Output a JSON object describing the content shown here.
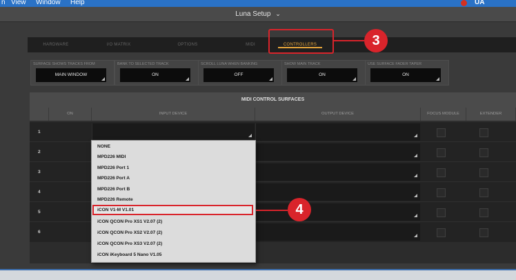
{
  "menubar": {
    "items": [
      "n",
      "View",
      "Window",
      "Help"
    ],
    "right_label": "UA"
  },
  "window": {
    "title": "Luna Setup"
  },
  "tabs": [
    {
      "label": "HARDWARE",
      "active": false
    },
    {
      "label": "I/O MATRIX",
      "active": false
    },
    {
      "label": "OPTIONS",
      "active": false
    },
    {
      "label": "MIDI",
      "active": false
    },
    {
      "label": "CONTROLLERS",
      "active": true
    }
  ],
  "callouts": {
    "step3": "3",
    "step4": "4"
  },
  "settings": [
    {
      "label": "SURFACE SHOWS TRACKS FROM",
      "value": "MAIN WINDOW"
    },
    {
      "label": "BANK TO SELECTED TRACK",
      "value": "ON"
    },
    {
      "label": "SCROLL LUNA WHEN BANKING",
      "value": "OFF"
    },
    {
      "label": "SHOW MAIN TRACK",
      "value": "ON"
    },
    {
      "label": "USE SURFACE FADER TAPER",
      "value": "ON"
    }
  ],
  "midi_section": {
    "title": "MIDI CONTROL SURFACES",
    "columns": [
      "ON",
      "INPUT DEVICE",
      "OUTPUT DEVICE",
      "FOCUS MODULE",
      "EXTENDER"
    ],
    "rows": [
      "1",
      "2",
      "3",
      "4",
      "5",
      "6"
    ]
  },
  "dropdown": {
    "options": [
      "NONE",
      "MPD226 MIDI",
      "MPD226 Port 1",
      "MPD226 Port A",
      "MPD226 Port B",
      "MPD226 Remote",
      "iCON V1-M V1.01",
      "iCON QCON Pro XS1 V2.07 (2)",
      "iCON QCON Pro XS2 V2.07 (2)",
      "iCON QCON Pro XS3 V2.07 (2)",
      "iCON iKeyboard 5 Nano V1.05"
    ],
    "highlighted_index": 6
  },
  "colors": {
    "accent": "#e9a73b",
    "callout": "#d9242b",
    "menubar": "#2a72c6"
  }
}
